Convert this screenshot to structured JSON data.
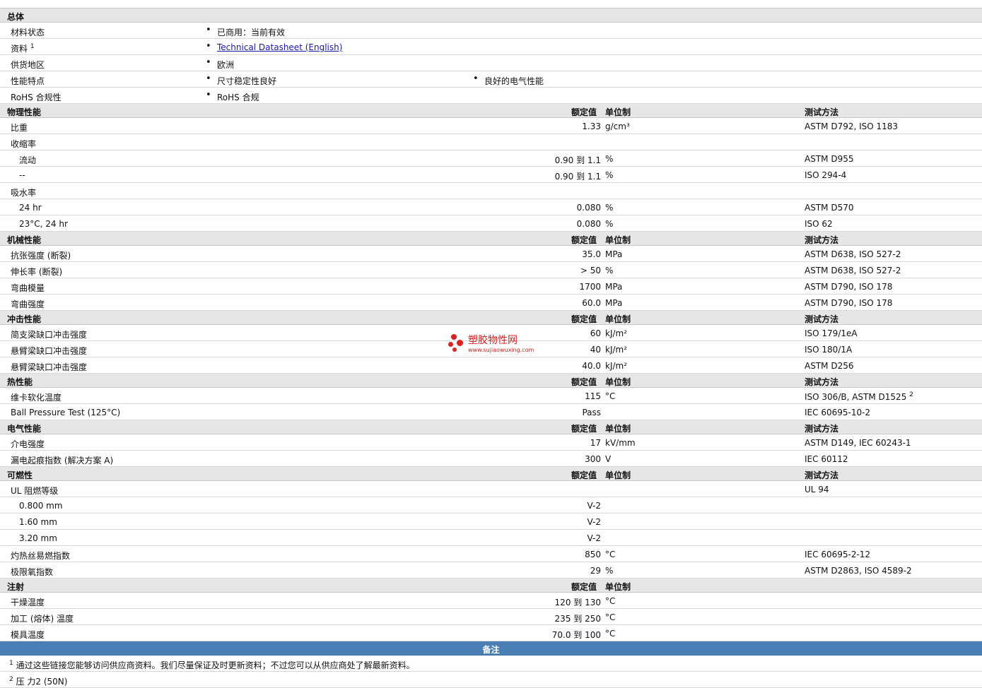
{
  "general": {
    "title": "总体",
    "rows": [
      {
        "label": "材料状态",
        "items": [
          "已商用：当前有效"
        ]
      },
      {
        "label": "资料",
        "sup": "1",
        "items": [
          "Technical Datasheet (English)"
        ],
        "link": true
      },
      {
        "label": "供货地区",
        "items": [
          "欧洲"
        ]
      },
      {
        "label": "性能特点",
        "items": [
          "尺寸稳定性良好",
          "良好的电气性能"
        ]
      },
      {
        "label": "RoHS 合规性",
        "items": [
          "RoHS 合规"
        ]
      }
    ]
  },
  "headers": {
    "value": "额定值",
    "unit": "单位制",
    "test": "测试方法"
  },
  "sections": [
    {
      "title": "物理性能",
      "show_test": true,
      "rows": [
        {
          "label": "比重",
          "value": "1.33",
          "unit": "g/cm³",
          "test": "ASTM D792, ISO 1183"
        },
        {
          "label": "收缩率",
          "value": "",
          "unit": "",
          "test": ""
        },
        {
          "label": "流动",
          "sub": true,
          "value": "0.90 到  1.1",
          "unit": "%",
          "test": "ASTM D955"
        },
        {
          "label": "--",
          "sub": true,
          "value": "0.90 到  1.1",
          "unit": "%",
          "test": "ISO 294-4"
        },
        {
          "label": "吸水率",
          "value": "",
          "unit": "",
          "test": ""
        },
        {
          "label": "24 hr",
          "sub": true,
          "value": "0.080",
          "unit": "%",
          "test": "ASTM D570"
        },
        {
          "label": "23°C, 24 hr",
          "sub": true,
          "value": "0.080",
          "unit": "%",
          "test": "ISO 62"
        }
      ]
    },
    {
      "title": "机械性能",
      "show_test": true,
      "rows": [
        {
          "label": "抗张强度 (断裂)",
          "value": "35.0",
          "unit": "MPa",
          "test": "ASTM D638, ISO 527-2"
        },
        {
          "label": "伸长率 (断裂)",
          "value": "> 50",
          "unit": "%",
          "test": "ASTM D638, ISO 527-2"
        },
        {
          "label": "弯曲模量",
          "value": "1700",
          "unit": "MPa",
          "test": "ASTM D790, ISO 178"
        },
        {
          "label": "弯曲强度",
          "value": "60.0",
          "unit": "MPa",
          "test": "ASTM D790, ISO 178"
        }
      ]
    },
    {
      "title": "冲击性能",
      "show_test": true,
      "rows": [
        {
          "label": "简支梁缺口冲击强度",
          "value": "60",
          "unit": "kJ/m²",
          "test": "ISO 179/1eA"
        },
        {
          "label": "悬臂梁缺口冲击强度",
          "value": "40",
          "unit": "kJ/m²",
          "test": "ISO 180/1A"
        },
        {
          "label": "悬臂梁缺口冲击强度",
          "value": "40.0",
          "unit": "kJ/m²",
          "test": "ASTM D256"
        }
      ]
    },
    {
      "title": "热性能",
      "show_test": true,
      "rows": [
        {
          "label": "维卡软化温度",
          "value": "115",
          "unit": "°C",
          "test": "ISO 306/B, ASTM D1525",
          "test_sup": "2"
        },
        {
          "label": "Ball Pressure Test (125°C)",
          "value": "Pass",
          "unit": "",
          "test": "IEC 60695-10-2"
        }
      ]
    },
    {
      "title": "电气性能",
      "show_test": true,
      "rows": [
        {
          "label": "介电强度",
          "value": "17",
          "unit": "kV/mm",
          "test": "ASTM D149, IEC 60243-1"
        },
        {
          "label": "漏电起痕指数 (解决方案 A)",
          "value": "300",
          "unit": "V",
          "test": "IEC 60112"
        }
      ]
    },
    {
      "title": "可燃性",
      "show_test": true,
      "rows": [
        {
          "label": "UL 阻燃等级",
          "value": "",
          "unit": "",
          "test": "UL 94"
        },
        {
          "label": "0.800 mm",
          "sub": true,
          "value": "V-2",
          "unit": "",
          "test": ""
        },
        {
          "label": "1.60 mm",
          "sub": true,
          "value": "V-2",
          "unit": "",
          "test": ""
        },
        {
          "label": "3.20 mm",
          "sub": true,
          "value": "V-2",
          "unit": "",
          "test": ""
        },
        {
          "label": "灼热丝易燃指数",
          "value": "850",
          "unit": "°C",
          "test": "IEC 60695-2-12"
        },
        {
          "label": "极限氧指数",
          "value": "29",
          "unit": "%",
          "test": "ASTM D2863, ISO 4589-2"
        }
      ]
    },
    {
      "title": "注射",
      "show_test": false,
      "rows": [
        {
          "label": "干燥温度",
          "value": "120 到  130",
          "unit": "°C",
          "test": ""
        },
        {
          "label": "加工 (熔体) 温度",
          "value": "235 到  250",
          "unit": "°C",
          "test": ""
        },
        {
          "label": "模具温度",
          "value": "70.0 到  100",
          "unit": "°C",
          "test": ""
        }
      ]
    }
  ],
  "notes": {
    "title": "备注",
    "items": [
      {
        "sup": "1",
        "text": "通过这些链接您能够访问供应商资料。我们尽量保证及时更新资料；不过您可以从供应商处了解最新资料。"
      },
      {
        "sup": "2",
        "text": "压  力2 (50N)"
      }
    ]
  },
  "watermark": {
    "name": "塑胶物性网",
    "url": "www.sujiaowuxing.com",
    "color": "#e02020"
  },
  "colors": {
    "section_bg": "#e6e6e6",
    "notes_header_bg": "#4a7fb5"
  }
}
